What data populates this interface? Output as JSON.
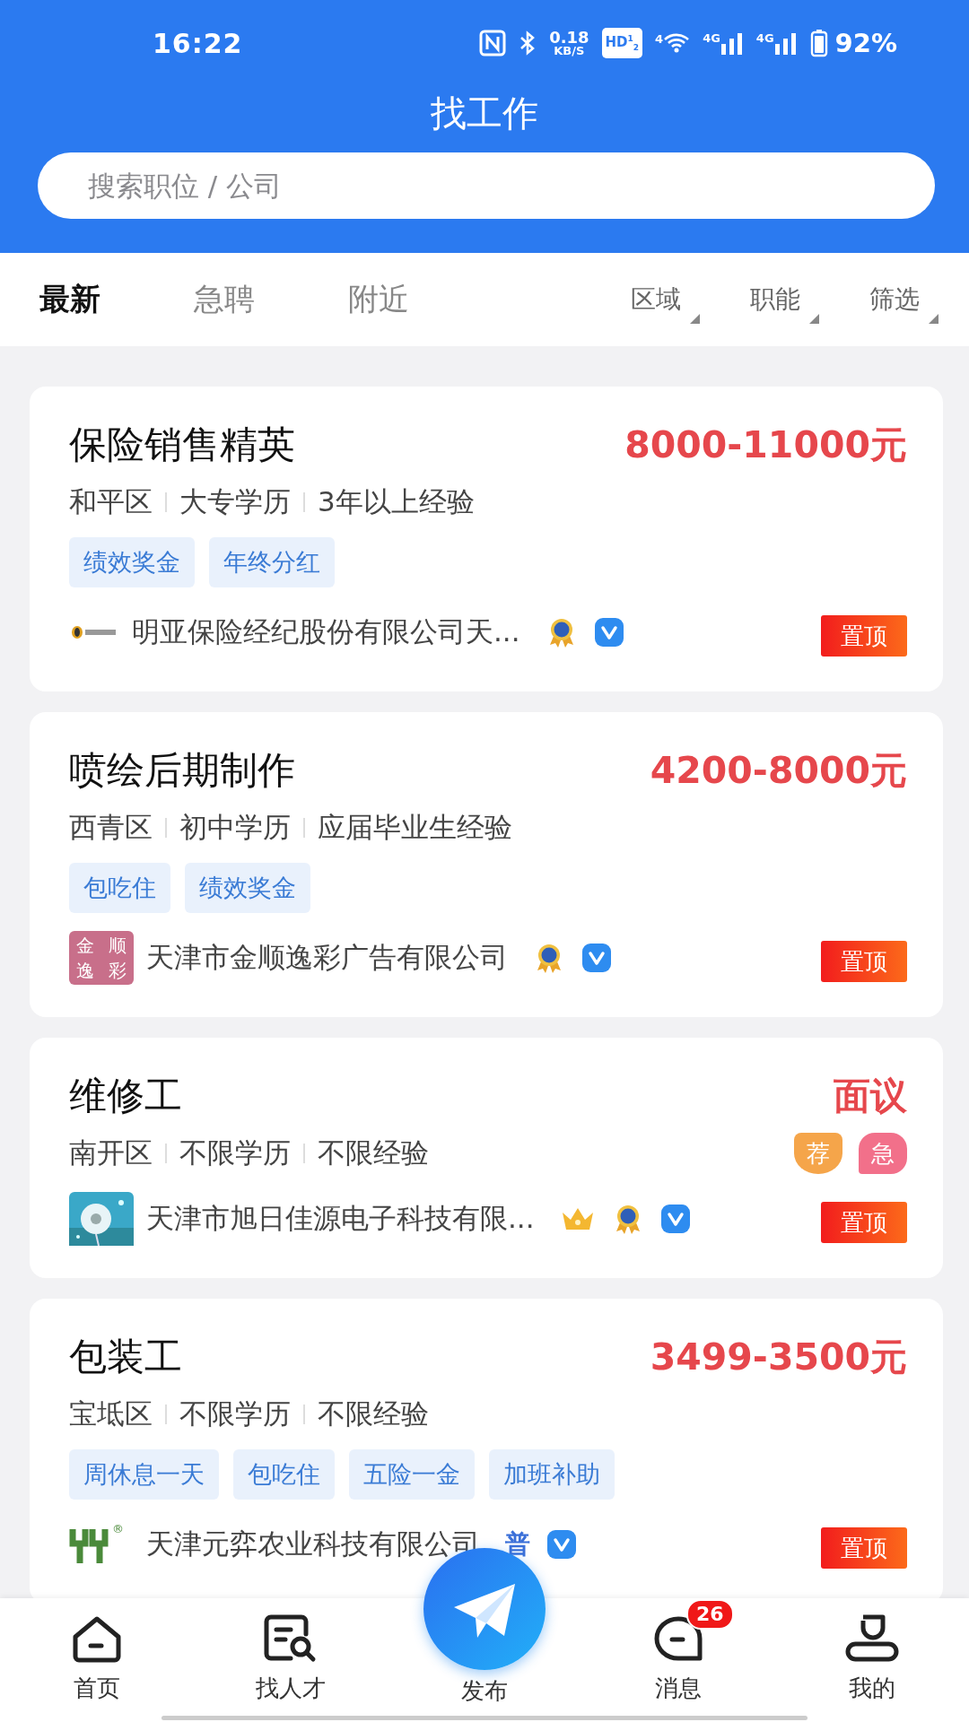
{
  "status_bar": {
    "time": "16:22",
    "net_speed": "0.18",
    "net_unit": "KB/S",
    "hd": "HD$^{1}$$_{2}$",
    "wifi_label": "4",
    "signals": [
      "4G",
      "4G"
    ],
    "battery": "92%"
  },
  "header": {
    "title": "找工作",
    "search": {
      "placeholder": "搜索职位 / 公司"
    }
  },
  "tabs": [
    {
      "label": "最新",
      "selected": true
    },
    {
      "label": "急聘",
      "selected": false
    },
    {
      "label": "附近",
      "selected": false
    }
  ],
  "filters": [
    "区域",
    "职能",
    "筛选"
  ],
  "jobs": [
    {
      "title": "保险销售精英",
      "salary": "8000-11000元",
      "meta": [
        "和平区",
        "大专学历",
        "3年以上经验"
      ],
      "tags": [
        "绩效奖金",
        "年终分红"
      ],
      "company": {
        "logo": {
          "kind": "coin"
        },
        "name": "明亚保险经纪股份有限公司天...",
        "badges": [
          {
            "kind": "medal"
          },
          {
            "kind": "verified"
          }
        ]
      },
      "pin": "置顶"
    },
    {
      "title": "喷绘后期制作",
      "salary": "4200-8000元",
      "meta": [
        "西青区",
        "初中学历",
        "应届毕业生经验"
      ],
      "tags": [
        "包吃住",
        "绩效奖金"
      ],
      "company": {
        "logo": {
          "kind": "tile",
          "chars": [
            "金",
            "顺",
            "逸",
            "彩"
          ]
        },
        "name": "天津市金顺逸彩广告有限公司",
        "badges": [
          {
            "kind": "medal"
          },
          {
            "kind": "verified"
          }
        ]
      },
      "pin": "置顶"
    },
    {
      "title": "维修工",
      "salary": "面议",
      "meta": [
        "南开区",
        "不限学历",
        "不限经验"
      ],
      "flags": [
        {
          "kind": "recommend",
          "text": "荐"
        },
        {
          "kind": "urgent",
          "text": "急"
        }
      ],
      "company": {
        "name": "天津市旭日佳源电子科技有限...",
        "badges": [
          {
            "kind": "crown"
          },
          {
            "kind": "medal"
          },
          {
            "kind": "verified"
          }
        ]
      },
      "pin": "置顶"
    },
    {
      "title": "包装工",
      "salary": "3499-3500元",
      "meta": [
        "宝坻区",
        "不限学历",
        "不限经验"
      ],
      "tags": [
        "周休息一天",
        "包吃住",
        "五险一金",
        "加班补助"
      ],
      "company": {
        "logo": {
          "kind": "monogram",
          "mark": "®"
        },
        "name": "天津元弈农业科技有限公司",
        "badges": [
          {
            "kind": "level",
            "text": "普"
          },
          {
            "kind": "verified"
          }
        ]
      },
      "pin": "置顶"
    }
  ],
  "nav": {
    "items": [
      {
        "label": "首页",
        "kind": "home"
      },
      {
        "label": "找人才",
        "kind": "talent"
      },
      {
        "label": "发布",
        "kind": "publish"
      },
      {
        "label": "消息",
        "kind": "message",
        "badge": "26"
      },
      {
        "label": "我的",
        "kind": "profile"
      }
    ]
  }
}
